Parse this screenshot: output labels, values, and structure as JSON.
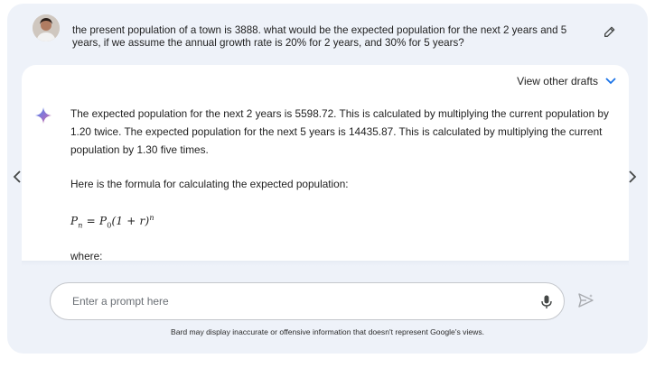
{
  "prompt": {
    "text": "the present population of a town is 3888. what would be the expected population for the next 2 years and 5 years, if we assume the annual growth rate is 20% for 2 years, and 30% for 5 years?",
    "avatar_icon": "user-avatar",
    "edit_icon": "pencil-icon"
  },
  "response": {
    "drafts_label": "View other drafts",
    "paragraph1": "The expected population for the next 2 years is 5598.72. This is calculated by multiplying the current population by 1.20 twice. The expected population for the next 5 years is 14435.87. This is calculated by multiplying the current population by 1.30 five times.",
    "paragraph2": "Here is the formula for calculating the expected population:",
    "formula": {
      "lhs": "P",
      "lhs_sub": "n",
      "eq": " = ",
      "p0": "P",
      "p0_sub": "0",
      "body": "(1 + r)",
      "exp": "n"
    },
    "paragraph3": "where:"
  },
  "input": {
    "placeholder": "Enter a prompt here",
    "value": ""
  },
  "disclaimer": "Bard may display inaccurate or offensive information that doesn't represent Google's views.",
  "colors": {
    "background": "#eef2f9",
    "card": "#ffffff",
    "accent_blue": "#1a73e8",
    "sparkle_blue": "#4285f4",
    "sparkle_red": "#d96570"
  }
}
